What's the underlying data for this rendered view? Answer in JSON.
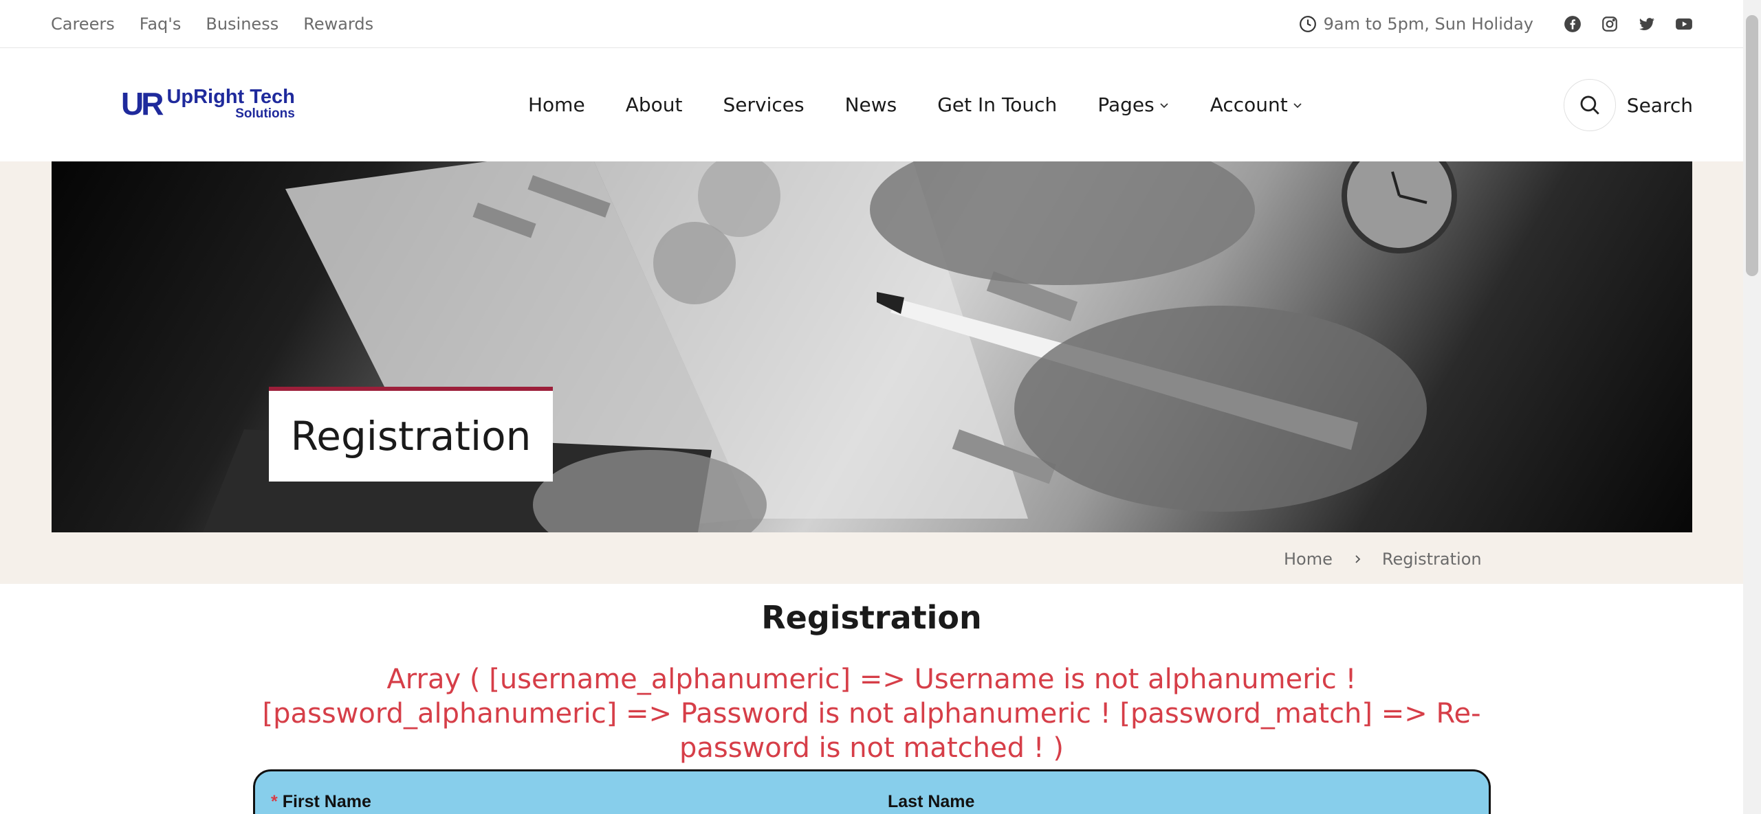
{
  "topbar": {
    "links": [
      "Careers",
      "Faq's",
      "Business",
      "Rewards"
    ],
    "hours": "9am to 5pm, Sun Holiday",
    "socials": [
      "facebook-icon",
      "instagram-icon",
      "twitter-icon",
      "youtube-icon"
    ]
  },
  "header": {
    "logo_mark": "UR",
    "logo_line1": "UpRight Tech",
    "logo_line2": "Solutions",
    "nav": [
      "Home",
      "About",
      "Services",
      "News",
      "Get In Touch",
      "Pages",
      "Account"
    ],
    "search_label": "Search"
  },
  "hero": {
    "title": "Registration"
  },
  "breadcrumb": {
    "home": "Home",
    "current": "Registration"
  },
  "main": {
    "heading": "Registration",
    "error": "Array ( [username_alphanumeric] => Username is not alphanumeric ! [password_alphanumeric] => Password is not alphanumeric ! [password_match] => Re-password is not matched ! )",
    "first_name_label": "First Name",
    "last_name_label": "Last Name",
    "required_mark": "*"
  },
  "colors": {
    "accent": "#9c1f3a",
    "error": "#d63e48",
    "form_bg": "#87ceeb",
    "logo": "#1f2a9c"
  }
}
